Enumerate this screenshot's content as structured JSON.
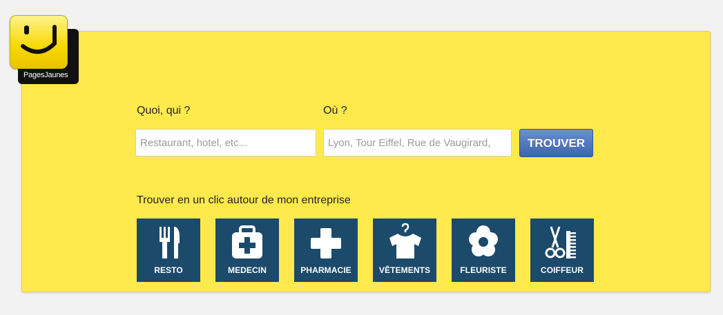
{
  "brand": {
    "logo_text": "PagesJaunes"
  },
  "search": {
    "what_label": "Quoi, qui ?",
    "what_placeholder": "Restaurant, hotel, etc...",
    "where_label": "Où ?",
    "where_placeholder": "Lyon, Tour Eiffel, Rue de Vaugirard,",
    "button_label": "TROUVER"
  },
  "quick": {
    "title": "Trouver en un clic autour de mon entreprise",
    "categories": [
      {
        "label": "RESTO",
        "icon": "utensils-icon"
      },
      {
        "label": "MEDECIN",
        "icon": "medical-kit-icon"
      },
      {
        "label": "PHARMACIE",
        "icon": "pharmacy-cross-icon"
      },
      {
        "label": "VÊTEMENTS",
        "icon": "tshirt-hanger-icon"
      },
      {
        "label": "FLEURISTE",
        "icon": "flower-icon"
      },
      {
        "label": "COIFFEUR",
        "icon": "scissors-comb-icon"
      }
    ]
  },
  "colors": {
    "background": "#ffe94d",
    "tile": "#1b4a6b",
    "button": "#3e64ad"
  }
}
